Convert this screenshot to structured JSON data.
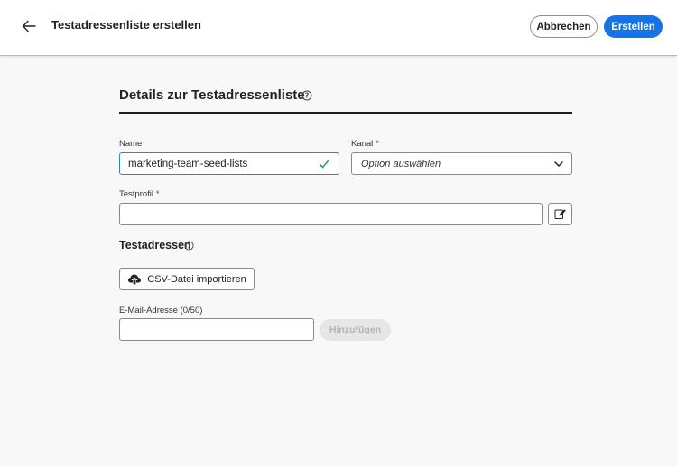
{
  "header": {
    "title": "Testadressenliste erstellen",
    "cancel_label": "Abbrechen",
    "create_label": "Erstellen"
  },
  "details": {
    "title": "Details zur Testadressenliste"
  },
  "form": {
    "name": {
      "label": "Name",
      "value": "marketing-team-seed-lists",
      "validated": true
    },
    "channel": {
      "label": "Kanal",
      "required_marker": "*",
      "placeholder": "Option auswählen"
    },
    "test_profile": {
      "label": "Testprofil",
      "required_marker": "*",
      "value": ""
    }
  },
  "addresses": {
    "title": "Testadressen",
    "import_label": "CSV-Datei importieren",
    "email_label": "E-Mail-Adresse (0/50)",
    "email_value": "",
    "add_label": "Hinzufügen",
    "add_enabled": false
  },
  "colors": {
    "accent": "#1473e6",
    "valid": "#2d9d78"
  }
}
